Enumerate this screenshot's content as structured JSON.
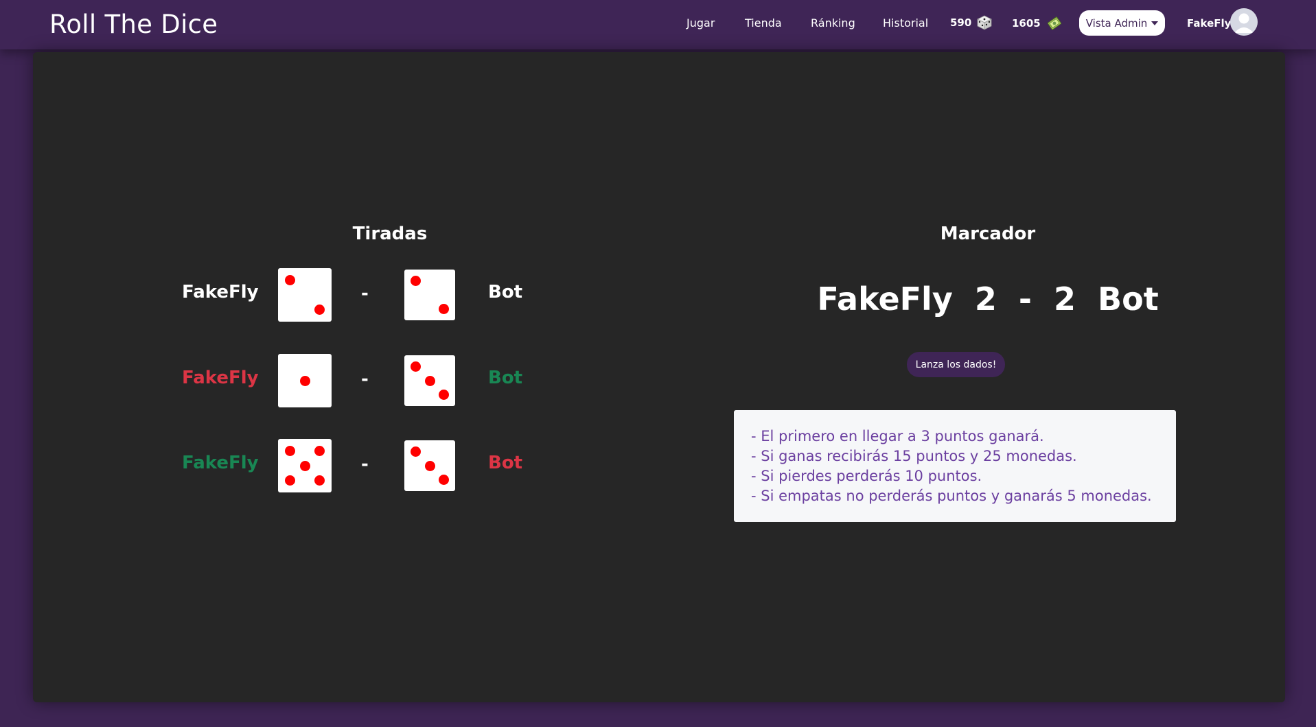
{
  "navbar": {
    "brand": "Roll The Dice",
    "links": [
      "Jugar",
      "Tienda",
      "Ránking",
      "Historial"
    ],
    "points": "590",
    "points_icon": "dice-icon",
    "coins": "1605",
    "coins_icon": "money-icon",
    "admin_button": "Vista Admin",
    "username": "FakeFly"
  },
  "tiradas": {
    "title": "Tiradas",
    "separator": "-",
    "rows": [
      {
        "player": "FakeFly",
        "player_die": 2,
        "bot_die": 2,
        "bot": "Bot",
        "player_color": "#ffffff",
        "bot_color": "#ffffff"
      },
      {
        "player": "FakeFly",
        "player_die": 1,
        "bot_die": 3,
        "bot": "Bot",
        "player_color": "#dc3545",
        "bot_color": "#198754"
      },
      {
        "player": "FakeFly",
        "player_die": 5,
        "bot_die": 3,
        "bot": "Bot",
        "player_color": "#198754",
        "bot_color": "#dc3545"
      }
    ]
  },
  "marcador": {
    "title": "Marcador",
    "score_text": "FakeFly  2  -  2  Bot",
    "roll_button": "Lanza los dados!",
    "rules": [
      "- El primero en llegar a 3 puntos ganará.",
      "- Si ganas recibirás 15 puntos y 25 monedas.",
      "- Si pierdes perderás 10 puntos.",
      "- Si empatas no perderás puntos y ganarás 5 monedas."
    ]
  },
  "colors": {
    "accent": "#3f2556",
    "panel": "#262626",
    "win": "#198754",
    "lose": "#dc3545",
    "pip": "#ff0000",
    "rules_text": "#6b3fa0"
  }
}
